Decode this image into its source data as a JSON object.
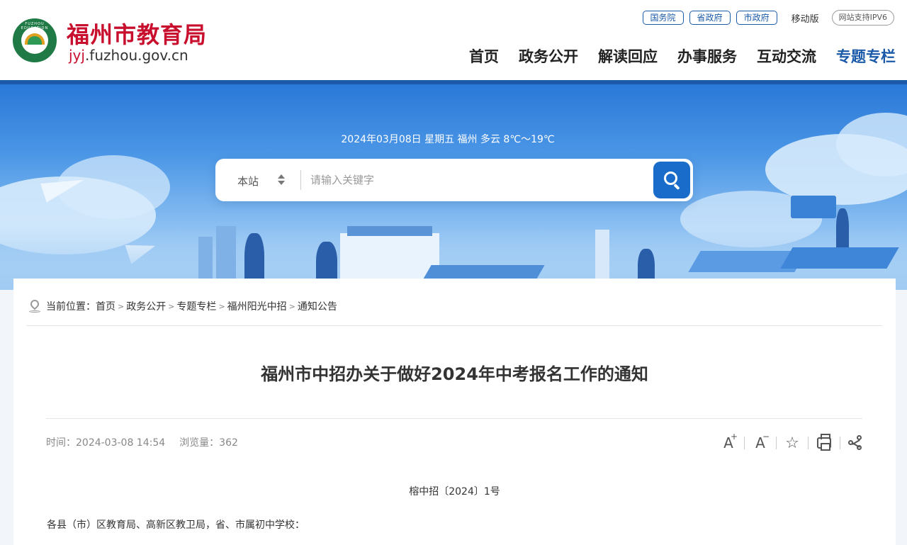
{
  "header": {
    "site_title": "福州市教育局",
    "domain_highlight": "jyj",
    "domain_rest": ".fuzhou.gov.cn",
    "emblem_text": "FUZHOU EDUCATION"
  },
  "top_links": {
    "gov_links": [
      "国务院",
      "省政府",
      "市政府"
    ],
    "mobile": "移动版",
    "ipv6": "网站支持IPV6"
  },
  "nav": {
    "items": [
      "首页",
      "政务公开",
      "解读回应",
      "办事服务",
      "互动交流",
      "专题专栏"
    ],
    "active_index": 5
  },
  "banner": {
    "date_weather": "2024年03月08日  星期五 福州 多云 8℃～19℃"
  },
  "search": {
    "scope": "本站",
    "placeholder": "请输入关键字"
  },
  "breadcrumb": {
    "prefix": "当前位置：",
    "items": [
      "首页",
      "政务公开",
      "专题专栏",
      "福州阳光中招",
      "通知公告"
    ]
  },
  "article": {
    "title": "福州市中招办关于做好2024年中考报名工作的通知",
    "time": "时间：2024-03-08 14:54",
    "views": "浏览量：362",
    "doc_number": "榕中招〔2024〕1号",
    "salutation": "各县（市）区教育局、高新区教卫局，省、市属初中学校："
  },
  "tools": {
    "font_increase": "A",
    "font_decrease": "A",
    "plus": "+",
    "minus": "−"
  },
  "colors": {
    "brand_red": "#c8102e",
    "brand_blue": "#1a5aa8",
    "search_button": "#1a6ccb"
  }
}
